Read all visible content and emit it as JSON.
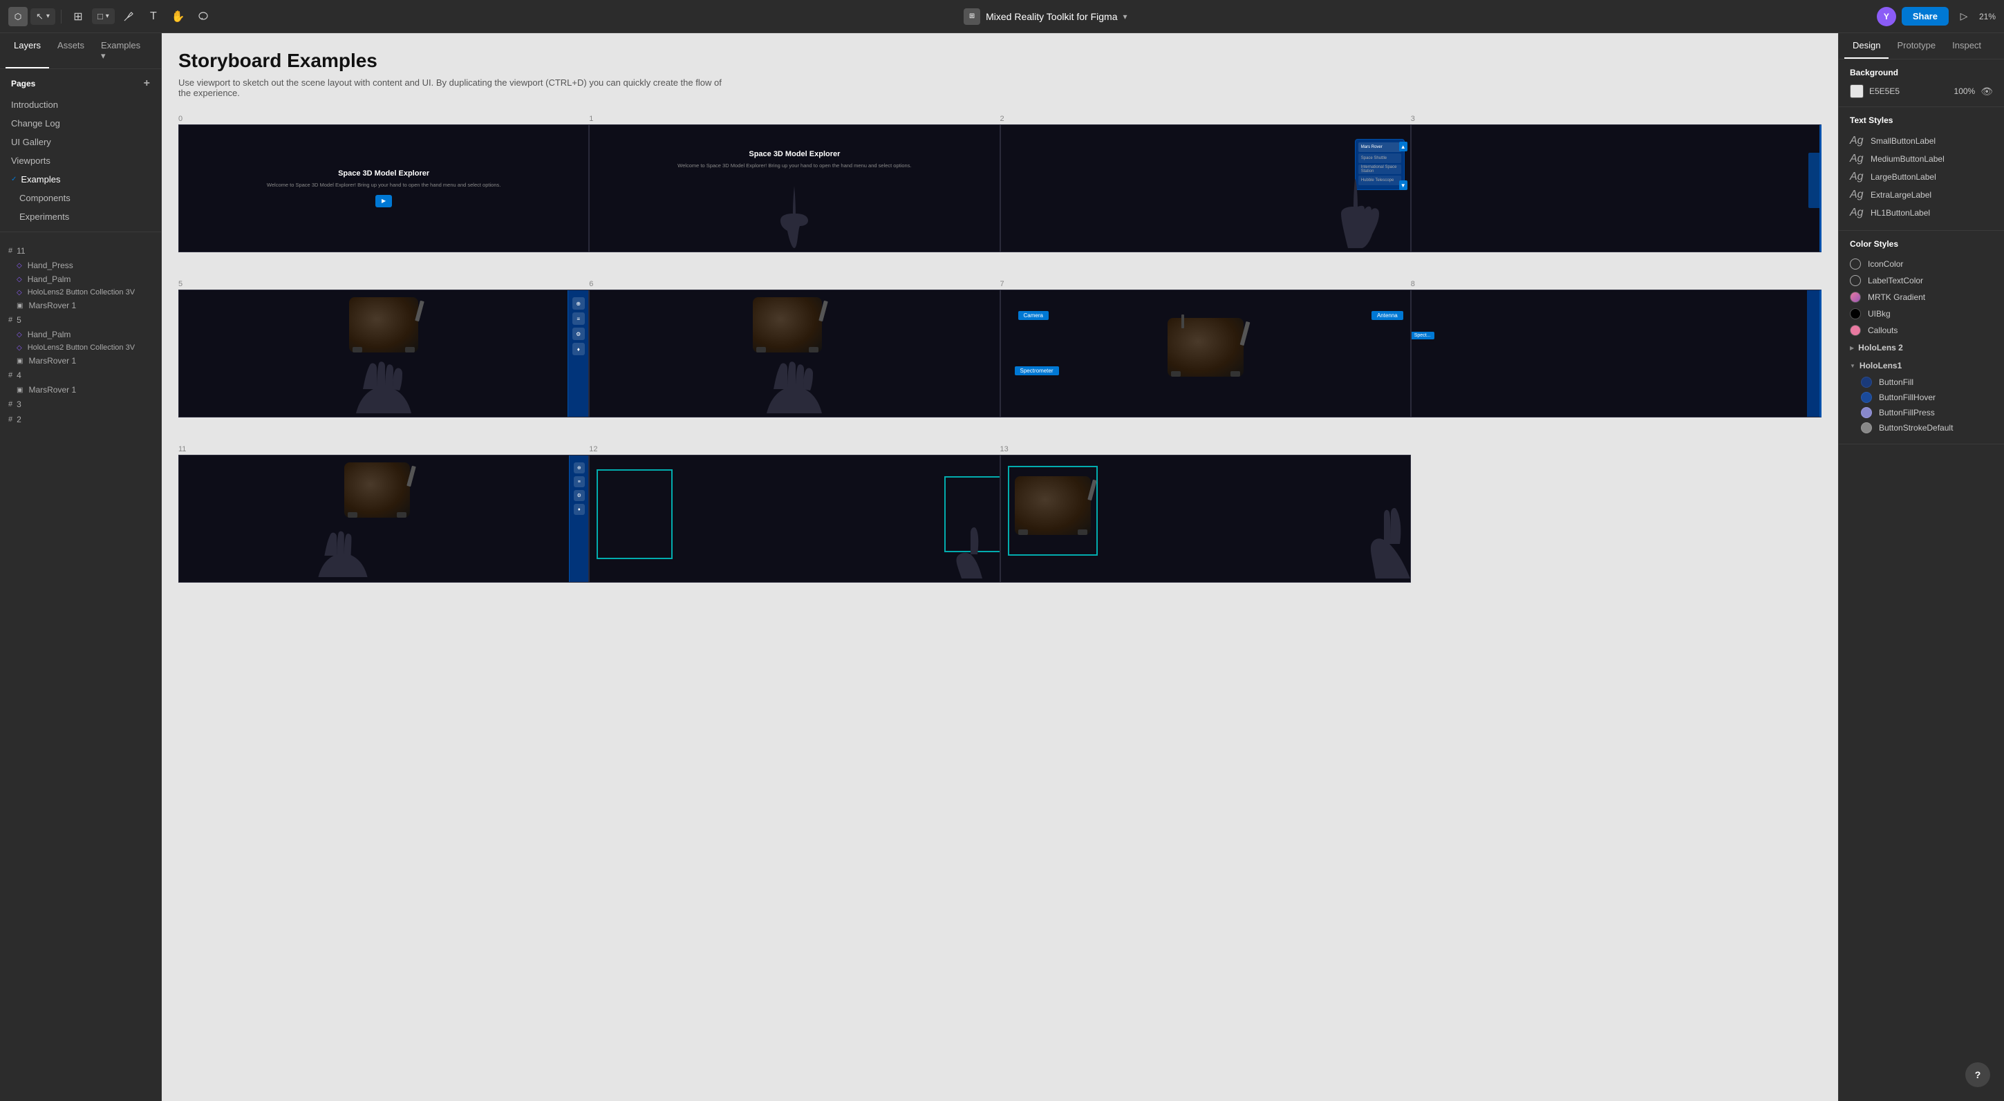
{
  "toolbar": {
    "app_icon": "⬡",
    "project_title": "Mixed Reality Toolkit for Figma",
    "project_dropdown": "▾",
    "zoom_level": "21%",
    "share_label": "Share",
    "play_icon": "▷",
    "avatar_initials": "Y",
    "tools": [
      {
        "name": "move-tool",
        "icon": "↖",
        "active": false
      },
      {
        "name": "frame-tool",
        "icon": "⊞",
        "active": false
      },
      {
        "name": "shape-tool",
        "icon": "□",
        "active": false
      },
      {
        "name": "pen-tool",
        "icon": "✏",
        "active": false
      },
      {
        "name": "text-tool",
        "icon": "T",
        "active": false
      },
      {
        "name": "hand-tool",
        "icon": "✋",
        "active": false
      },
      {
        "name": "comment-tool",
        "icon": "💬",
        "active": false
      }
    ]
  },
  "left_panel": {
    "tabs": [
      {
        "name": "layers-tab",
        "label": "Layers",
        "active": true
      },
      {
        "name": "assets-tab",
        "label": "Assets",
        "active": false
      },
      {
        "name": "examples-tab",
        "label": "Examples ▾",
        "active": false
      }
    ],
    "pages_label": "Pages",
    "pages_add_icon": "+",
    "pages": [
      {
        "name": "introduction-page",
        "label": "Introduction",
        "active": false,
        "check": false
      },
      {
        "name": "changelog-page",
        "label": "Change Log",
        "active": false
      },
      {
        "name": "ui-gallery-page",
        "label": "UI Gallery",
        "active": false
      },
      {
        "name": "viewports-page",
        "label": "Viewports",
        "active": false
      },
      {
        "name": "examples-page",
        "label": "Examples",
        "active": true,
        "expanded": true,
        "check": true
      },
      {
        "name": "components-page",
        "label": "Components",
        "sub": true
      },
      {
        "name": "experiments-page",
        "label": "Experiments",
        "sub": true
      }
    ],
    "layers": [
      {
        "group": "11",
        "items": [
          {
            "name": "hand-press-layer",
            "label": "Hand_Press",
            "icon": "◇",
            "colored": true
          },
          {
            "name": "hand-palm-1-layer",
            "label": "Hand_Palm",
            "icon": "◇",
            "colored": true
          },
          {
            "name": "holoblc-3v-1-layer",
            "label": "HoloLens2 Button Collection 3V",
            "icon": "◇",
            "colored": true
          },
          {
            "name": "marsrover-1-1-layer",
            "label": "MarsRover 1",
            "icon": "▣",
            "colored": false
          }
        ]
      },
      {
        "group": "5",
        "items": [
          {
            "name": "hand-palm-2-layer",
            "label": "Hand_Palm",
            "icon": "◇",
            "colored": true
          },
          {
            "name": "holoblc-3v-2-layer",
            "label": "HoloLens2 Button Collection 3V",
            "icon": "◇",
            "colored": true
          },
          {
            "name": "marsrover-1-2-layer",
            "label": "MarsRover 1",
            "icon": "▣",
            "colored": false
          }
        ]
      },
      {
        "group": "4",
        "items": [
          {
            "name": "marsrover-1-3-layer",
            "label": "MarsRover 1",
            "icon": "▣",
            "colored": false
          }
        ]
      },
      {
        "group": "3",
        "items": []
      },
      {
        "group": "2",
        "items": []
      }
    ]
  },
  "canvas": {
    "title": "Storyboard Examples",
    "description": "Use viewport to sketch out the scene layout with content and UI. By duplicating the viewport (CTRL+D) you can quickly create the flow of the experience.",
    "frames": [
      {
        "row": 0,
        "cells": [
          {
            "number": "0",
            "type": "intro-text"
          },
          {
            "number": "1",
            "type": "hand-pointing"
          },
          {
            "number": "2",
            "type": "menu-select"
          },
          {
            "number": "3",
            "type": "dark-partial"
          }
        ]
      },
      {
        "row": 1,
        "cells": [
          {
            "number": "5",
            "type": "rover-hand-blue"
          },
          {
            "number": "6",
            "type": "rover-hand-plain"
          },
          {
            "number": "7",
            "type": "rover-labels"
          },
          {
            "number": "8",
            "type": "rover-partial-blue"
          }
        ]
      },
      {
        "row": 2,
        "cells": [
          {
            "number": "11",
            "type": "rover-hand-blue-small"
          },
          {
            "number": "12",
            "type": "teal-box"
          },
          {
            "number": "13",
            "type": "rover-teal-box-hand"
          }
        ]
      }
    ],
    "frame_title": "Space 3D Model Explorer",
    "frame_subtitle": "Welcome to Space 3D Model Explorer! Bring up your hand to open the hand menu and select options.",
    "tooltip_camera": "Camera",
    "tooltip_antenna": "Antenna",
    "tooltip_spectrometer": "Spectrometer"
  },
  "right_panel": {
    "tabs": [
      {
        "name": "design-tab",
        "label": "Design",
        "active": true
      },
      {
        "name": "prototype-tab",
        "label": "Prototype",
        "active": false
      },
      {
        "name": "inspect-tab",
        "label": "Inspect",
        "active": false
      }
    ],
    "background": {
      "label": "Background",
      "color": "#E5E5E5",
      "color_display": "E5E5E5",
      "opacity": "100%"
    },
    "text_styles": {
      "label": "Text Styles",
      "items": [
        {
          "name": "small-button-label-style",
          "label": "SmallButtonLabel"
        },
        {
          "name": "medium-button-label-style",
          "label": "MediumButtonLabel"
        },
        {
          "name": "large-button-label-style",
          "label": "LargeButtonLabel"
        },
        {
          "name": "extra-large-label-style",
          "label": "ExtraLargeLabel"
        },
        {
          "name": "hl1-button-label-style",
          "label": "HL1ButtonLabel"
        }
      ]
    },
    "color_styles": {
      "label": "Color Styles",
      "top_items": [
        {
          "name": "icon-color-style",
          "label": "IconColor",
          "color": "#fff",
          "dot_style": "border"
        },
        {
          "name": "label-text-color-style",
          "label": "LabelTextColor",
          "color": "#fff",
          "dot_style": "border"
        }
      ],
      "groups": [
        {
          "name": "mrtk-gradient-style",
          "label": "MRTK Gradient",
          "color": "#E879A0",
          "expanded": false
        },
        {
          "name": "uibkg-style",
          "label": "UIBkg",
          "color": "#000",
          "expanded": false
        },
        {
          "name": "callouts-style",
          "label": "Callouts",
          "color": "#E879A0",
          "expanded": false
        },
        {
          "name": "hololens2-group",
          "label": "HoloLens 2",
          "expanded": false,
          "arrow": "▶"
        },
        {
          "name": "hololens1-group",
          "label": "HoloLens1",
          "expanded": true,
          "arrow": "▼",
          "items": [
            {
              "name": "button-fill-style",
              "label": "ButtonFill",
              "color": "#1a3a7a"
            },
            {
              "name": "button-fill-hover-style",
              "label": "ButtonFillHover",
              "color": "#1a4a9a"
            },
            {
              "name": "button-fill-press-style",
              "label": "ButtonFillPress",
              "color": "#8888cc"
            },
            {
              "name": "button-stroke-default-style",
              "label": "ButtonStrokeDefault",
              "color": "#888"
            }
          ]
        }
      ]
    },
    "help_icon": "?"
  }
}
